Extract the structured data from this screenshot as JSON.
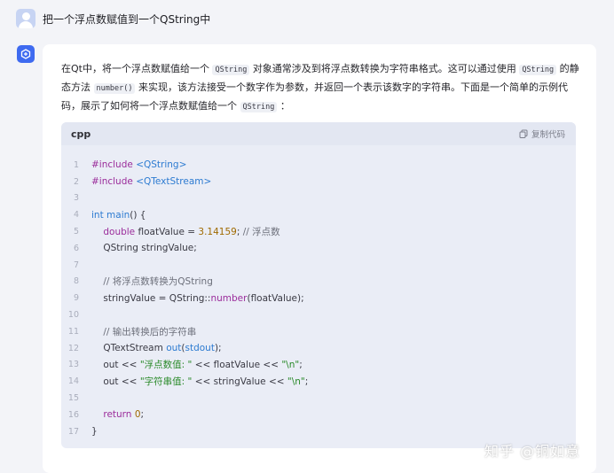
{
  "user": {
    "question": "把一个浮点数赋值到一个QString中"
  },
  "answer": {
    "p1": "在Qt中，将一个浮点数赋值给一个",
    "c1": "QString",
    "p2": "对象通常涉及到将浮点数转换为字符串格式。这可以通过使用",
    "c2": "QString",
    "p3": "的静态方法",
    "c3": "number()",
    "p4": "来实现，该方法接受一个数字作为参数，并返回一个表示该数字的字符串。下面是一个简单的示例代码，展示了如何将一个浮点数赋值给一个",
    "c4": "QString",
    "p5": "："
  },
  "code": {
    "language": "cpp",
    "copy_label": "复制代码",
    "lines": [
      {
        "n": "1",
        "t": [
          [
            "kw",
            "#include "
          ],
          [
            "type",
            "<QString>"
          ]
        ]
      },
      {
        "n": "2",
        "t": [
          [
            "kw",
            "#include "
          ],
          [
            "type",
            "<QTextStream>"
          ]
        ]
      },
      {
        "n": "3",
        "t": []
      },
      {
        "n": "4",
        "t": [
          [
            "type",
            "int "
          ],
          [
            "type",
            "main"
          ],
          [
            "txt",
            "() {"
          ]
        ]
      },
      {
        "n": "5",
        "t": [
          [
            "txt",
            "    "
          ],
          [
            "kw",
            "double"
          ],
          [
            "txt",
            " floatValue = "
          ],
          [
            "num",
            "3.14159"
          ],
          [
            "txt",
            "; "
          ],
          [
            "cm",
            "// 浮点数"
          ]
        ]
      },
      {
        "n": "6",
        "t": [
          [
            "txt",
            "    QString stringValue;"
          ]
        ]
      },
      {
        "n": "7",
        "t": []
      },
      {
        "n": "8",
        "t": [
          [
            "txt",
            "    "
          ],
          [
            "cm",
            "// 将浮点数转换为QString"
          ]
        ]
      },
      {
        "n": "9",
        "t": [
          [
            "txt",
            "    stringValue = QString::"
          ],
          [
            "kw",
            "number"
          ],
          [
            "txt",
            "(floatValue);"
          ]
        ]
      },
      {
        "n": "10",
        "t": []
      },
      {
        "n": "11",
        "t": [
          [
            "txt",
            "    "
          ],
          [
            "cm",
            "// 输出转换后的字符串"
          ]
        ]
      },
      {
        "n": "12",
        "t": [
          [
            "txt",
            "    QTextStream "
          ],
          [
            "type",
            "out"
          ],
          [
            "txt",
            "("
          ],
          [
            "type",
            "stdout"
          ],
          [
            "txt",
            ");"
          ]
        ]
      },
      {
        "n": "13",
        "t": [
          [
            "txt",
            "    out << "
          ],
          [
            "str",
            "\"浮点数值: \""
          ],
          [
            "txt",
            " << floatValue << "
          ],
          [
            "str",
            "\"\\n\""
          ],
          [
            "txt",
            ";"
          ]
        ]
      },
      {
        "n": "14",
        "t": [
          [
            "txt",
            "    out << "
          ],
          [
            "str",
            "\"字符串值: \""
          ],
          [
            "txt",
            " << stringValue << "
          ],
          [
            "str",
            "\"\\n\""
          ],
          [
            "txt",
            ";"
          ]
        ]
      },
      {
        "n": "15",
        "t": []
      },
      {
        "n": "16",
        "t": [
          [
            "txt",
            "    "
          ],
          [
            "kw",
            "return"
          ],
          [
            "txt",
            " "
          ],
          [
            "num",
            "0"
          ],
          [
            "txt",
            ";"
          ]
        ]
      },
      {
        "n": "17",
        "t": [
          [
            "txt",
            "}"
          ]
        ]
      }
    ]
  },
  "watermark": "知乎 @铜如意",
  "icons": {
    "user": "user-avatar-icon",
    "bot": "ai-assistant-icon",
    "copy": "copy-icon"
  },
  "colors": {
    "accent": "#3e6af0",
    "code_bg": "#eaedf6"
  }
}
